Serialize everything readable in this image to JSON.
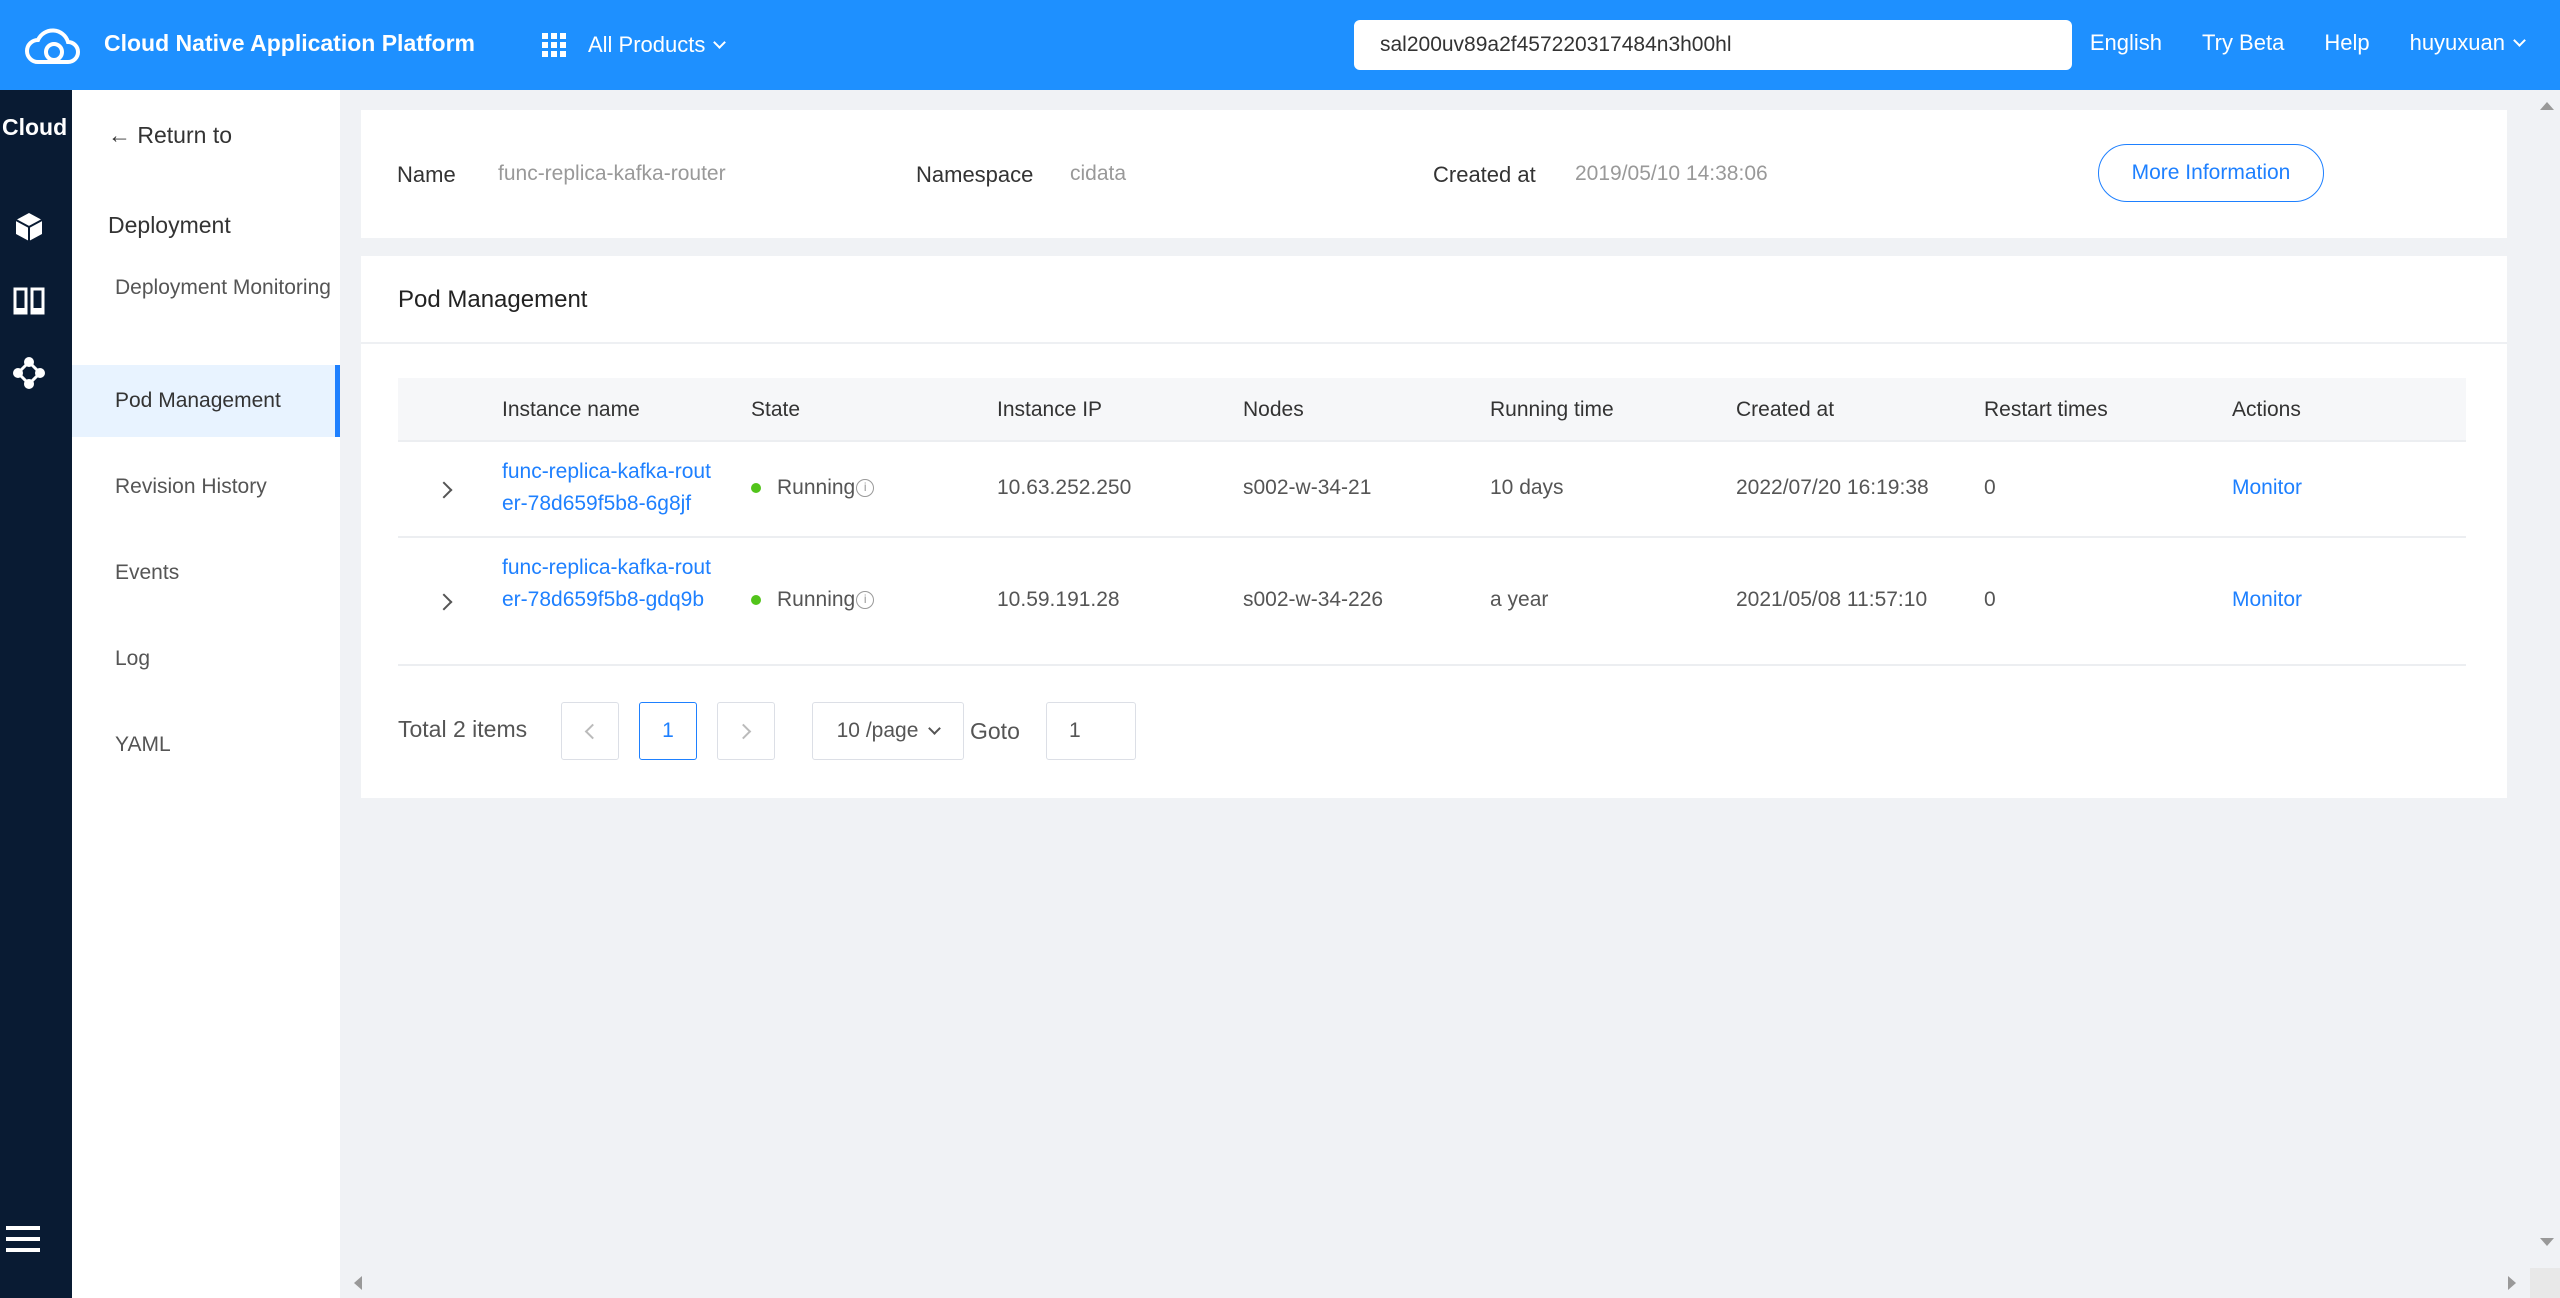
{
  "header": {
    "app_title": "Cloud Native Application Platform",
    "products_label": "All Products",
    "search_value": "sal200uv89a2f457220317484n3h00hl",
    "links": [
      "English",
      "Try Beta",
      "Help",
      "huyuxuan"
    ],
    "bg_color": "#1e90ff"
  },
  "rail": {
    "title": "Cloud",
    "icons": [
      "cube-icon",
      "columns-icon",
      "network-icon",
      "menu-icon"
    ]
  },
  "sidebar": {
    "back_label": "← Return to",
    "section_title": "Deployment",
    "items": [
      {
        "label": "Deployment Monitoring",
        "active": false
      },
      {
        "label": "Pod Management",
        "active": true
      },
      {
        "label": "Revision History",
        "active": false
      },
      {
        "label": "Events",
        "active": false
      },
      {
        "label": "Log",
        "active": false
      },
      {
        "label": "YAML",
        "active": false
      }
    ]
  },
  "info": {
    "name_label": "Name",
    "name_value": "func-replica-kafka-router",
    "namespace_label": "Namespace",
    "namespace_value": "cidata",
    "created_label": "Created at",
    "created_value": "2019/05/10 14:38:06",
    "more_button": "More Information"
  },
  "pods": {
    "title": "Pod Management",
    "columns": [
      "Instance name",
      "State",
      "Instance IP",
      "Nodes",
      "Running time",
      "Created at",
      "Restart times",
      "Actions"
    ],
    "rows": [
      {
        "name": "func-replica-kafka-router-78d659f5b8-6g8jf",
        "state": "Running",
        "ip": "10.63.252.250",
        "node": "s002-w-34-21",
        "running": "10 days",
        "created": "2022/07/20 16:19:38",
        "restarts": "0",
        "action": "Monitor"
      },
      {
        "name": "func-replica-kafka-router-78d659f5b8-gdq9b",
        "state": "Running",
        "ip": "10.59.191.28",
        "node": "s002-w-34-226",
        "running": "a year",
        "created": "2021/05/08 11:57:10",
        "restarts": "0",
        "action": "Monitor"
      }
    ],
    "pagination": {
      "total": "Total 2 items",
      "current_page": "1",
      "page_size": "10 /page",
      "goto_label": "Goto",
      "goto_value": "1"
    }
  },
  "colors": {
    "accent": "#1e80ff",
    "running": "#52c41a",
    "rail_bg": "#091b33"
  }
}
